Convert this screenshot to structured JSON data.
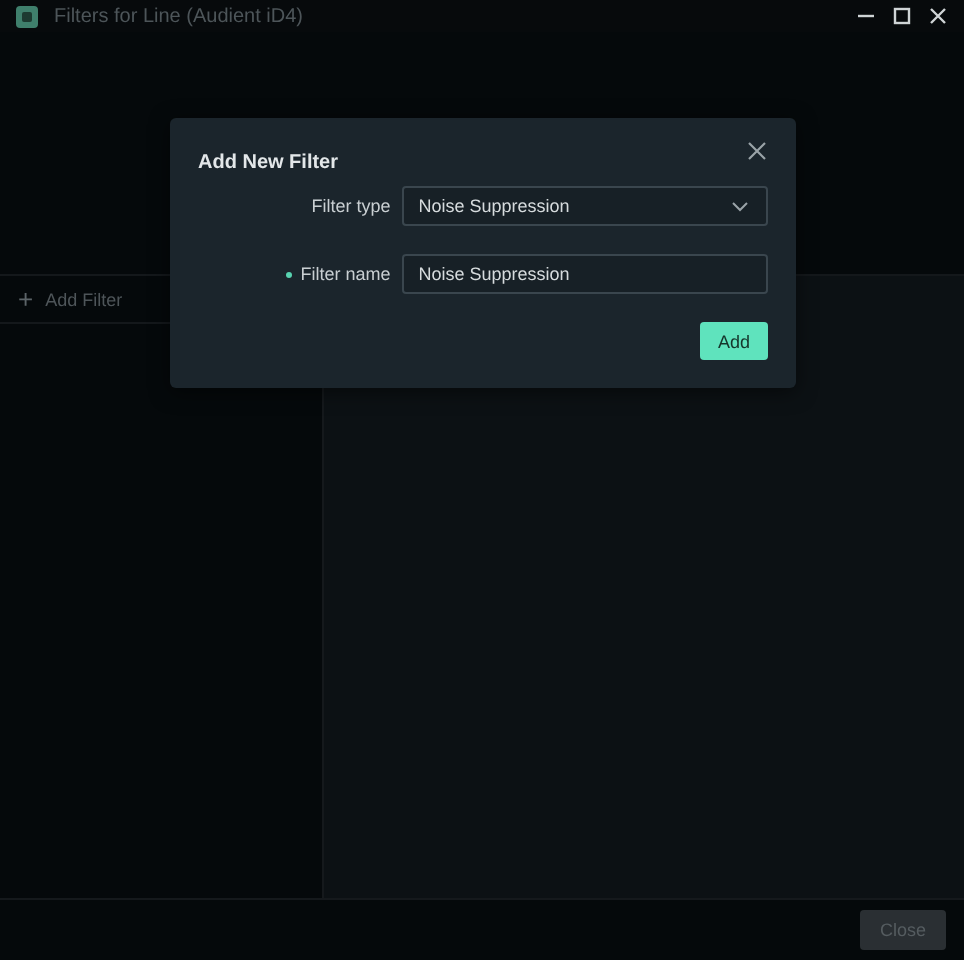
{
  "window": {
    "title": "Filters for Line (Audient iD4)"
  },
  "sidebar": {
    "add_button": {
      "icon": "+",
      "label": "Add Filter"
    }
  },
  "footer": {
    "close_button": {
      "label": "Close",
      "disabled": true
    }
  },
  "dialog": {
    "title": "Add New Filter",
    "fields": [
      {
        "kind": "dropdown",
        "label": "Filter type",
        "value": "Noise Suppression",
        "required": false
      },
      {
        "kind": "text",
        "label": "Filter name",
        "value": "Noise Suppression",
        "required": true
      }
    ],
    "submit": {
      "label": "Add"
    }
  }
}
